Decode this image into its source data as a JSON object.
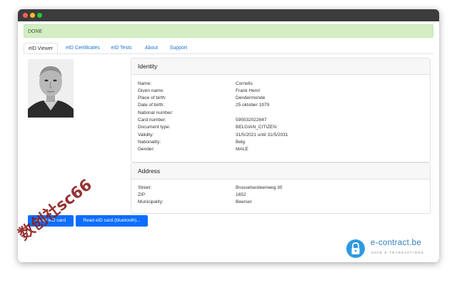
{
  "status": {
    "text": "DONE"
  },
  "tabs": [
    {
      "label": "eID Viewer",
      "active": true
    },
    {
      "label": "eID Certificates",
      "active": false
    },
    {
      "label": "eID Tests",
      "active": false
    },
    {
      "label": "About",
      "active": false
    },
    {
      "label": "Support",
      "active": false
    }
  ],
  "identity": {
    "title": "Identity",
    "rows": [
      {
        "label": "Name:",
        "value": "Cornelis"
      },
      {
        "label": "Given name:",
        "value": "Frank Henri"
      },
      {
        "label": "Place of birth:",
        "value": "Dendermonde"
      },
      {
        "label": "Date of birth:",
        "value": "25 oktober 1979"
      },
      {
        "label": "National number:",
        "value": ""
      },
      {
        "label": "Card number:",
        "value": "595032022647"
      },
      {
        "label": "Document type:",
        "value": "BELGIAN_CITIZEN"
      },
      {
        "label": "Validity:",
        "value": "31/5/2021 until 31/5/2031"
      },
      {
        "label": "Nationality:",
        "value": "Belg"
      },
      {
        "label": "Gender:",
        "value": "MALE"
      }
    ]
  },
  "address": {
    "title": "Address",
    "rows": [
      {
        "label": "Street:",
        "value": "Brusselsesteenweg 30"
      },
      {
        "label": "ZIP:",
        "value": "1652"
      },
      {
        "label": "Municipality:",
        "value": "Beersel"
      }
    ]
  },
  "buttons": {
    "read_card": "Read eID card",
    "read_bluetooth": "Read eID card (bluetooth)..."
  },
  "logo": {
    "name": "e-contract.be",
    "tagline": "SAFE E-TRANSACTIONS",
    "icon": "lock-icon"
  },
  "watermark": {
    "text": "数创社sc66"
  },
  "colors": {
    "accent": "#0d6efd",
    "status_bg": "#d4edc5",
    "logo": "#2d9be0"
  }
}
